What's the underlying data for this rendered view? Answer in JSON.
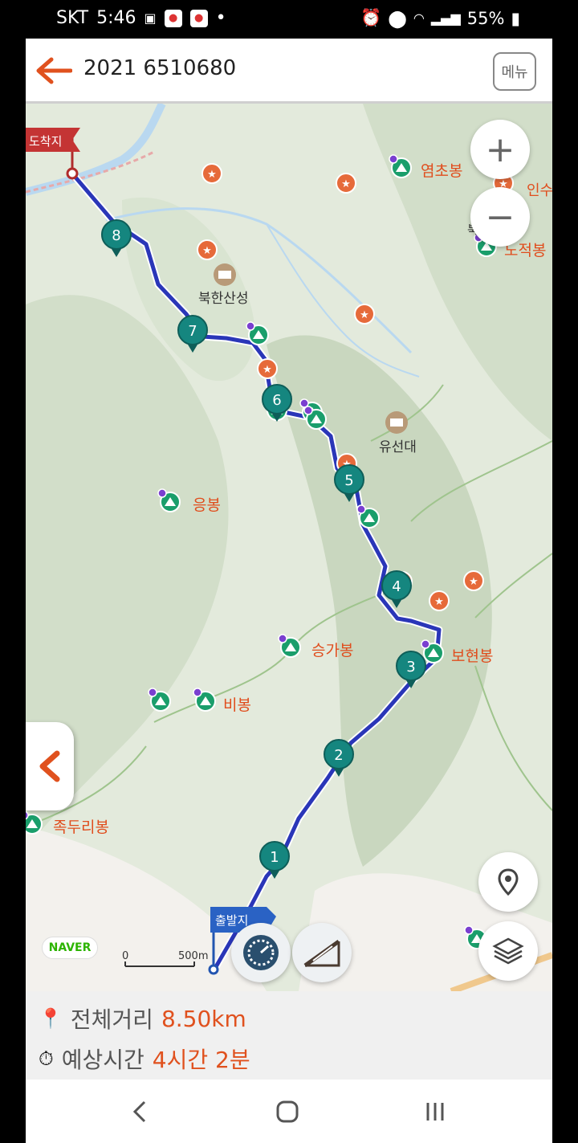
{
  "status_bar": {
    "carrier": "SKT",
    "time": "5:46",
    "battery": "55%"
  },
  "header": {
    "title": "2021 6510680",
    "menu_label": "메뉴"
  },
  "map": {
    "zoom_in_label": "+",
    "zoom_out_label": "−",
    "destination_label": "도착지",
    "start_label": "출발지",
    "provider": "NAVER",
    "scale_zero": "0",
    "scale_max": "500m",
    "peaks": [
      {
        "name": "염초봉"
      },
      {
        "name": "노적봉"
      },
      {
        "name": "응봉"
      },
      {
        "name": "승가봉"
      },
      {
        "name": "보현봉"
      },
      {
        "name": "비봉"
      },
      {
        "name": "족두리봉"
      }
    ],
    "places": [
      {
        "name": "북한산성"
      },
      {
        "name": "유선대"
      },
      {
        "name": "인수"
      },
      {
        "name": "북한"
      }
    ],
    "waypoints": [
      "1",
      "2",
      "3",
      "4",
      "5",
      "6",
      "7",
      "8"
    ],
    "colors": {
      "route": "#2a36b8",
      "waypoint": "#15867f",
      "accent": "#e0511e",
      "star": "#e66a3a"
    }
  },
  "summary": {
    "distance_label": "전체거리",
    "distance_value": "8.50km",
    "time_label": "예상시간",
    "time_value": "4시간 2분"
  },
  "nav": {
    "back": "back-icon",
    "home": "home-icon",
    "recents": "recents-icon"
  }
}
